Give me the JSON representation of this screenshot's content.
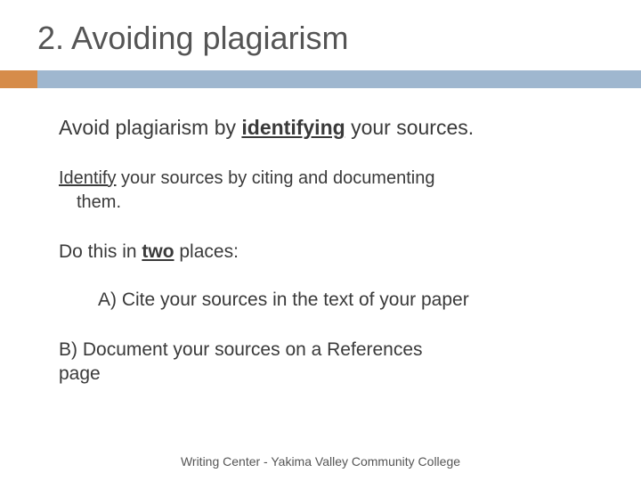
{
  "title": "2. Avoiding plagiarism",
  "line1_pre": "Avoid plagiarism by ",
  "line1_em": "identifying",
  "line1_post": " your sources.",
  "line2_em": "Identify",
  "line2_post": " your sources by citing and documenting",
  "line2b": "them.",
  "line3_pre": "Do this in ",
  "line3_em": "two",
  "line3_post": " places:",
  "itemA_label": "A)  ",
  "itemA_text": "Cite your sources in the text of your paper",
  "itemB_label": "B)  ",
  "itemB_text": "Document your sources on a References",
  "itemB_text2": "page",
  "footer": "Writing Center - Yakima Valley Community College"
}
